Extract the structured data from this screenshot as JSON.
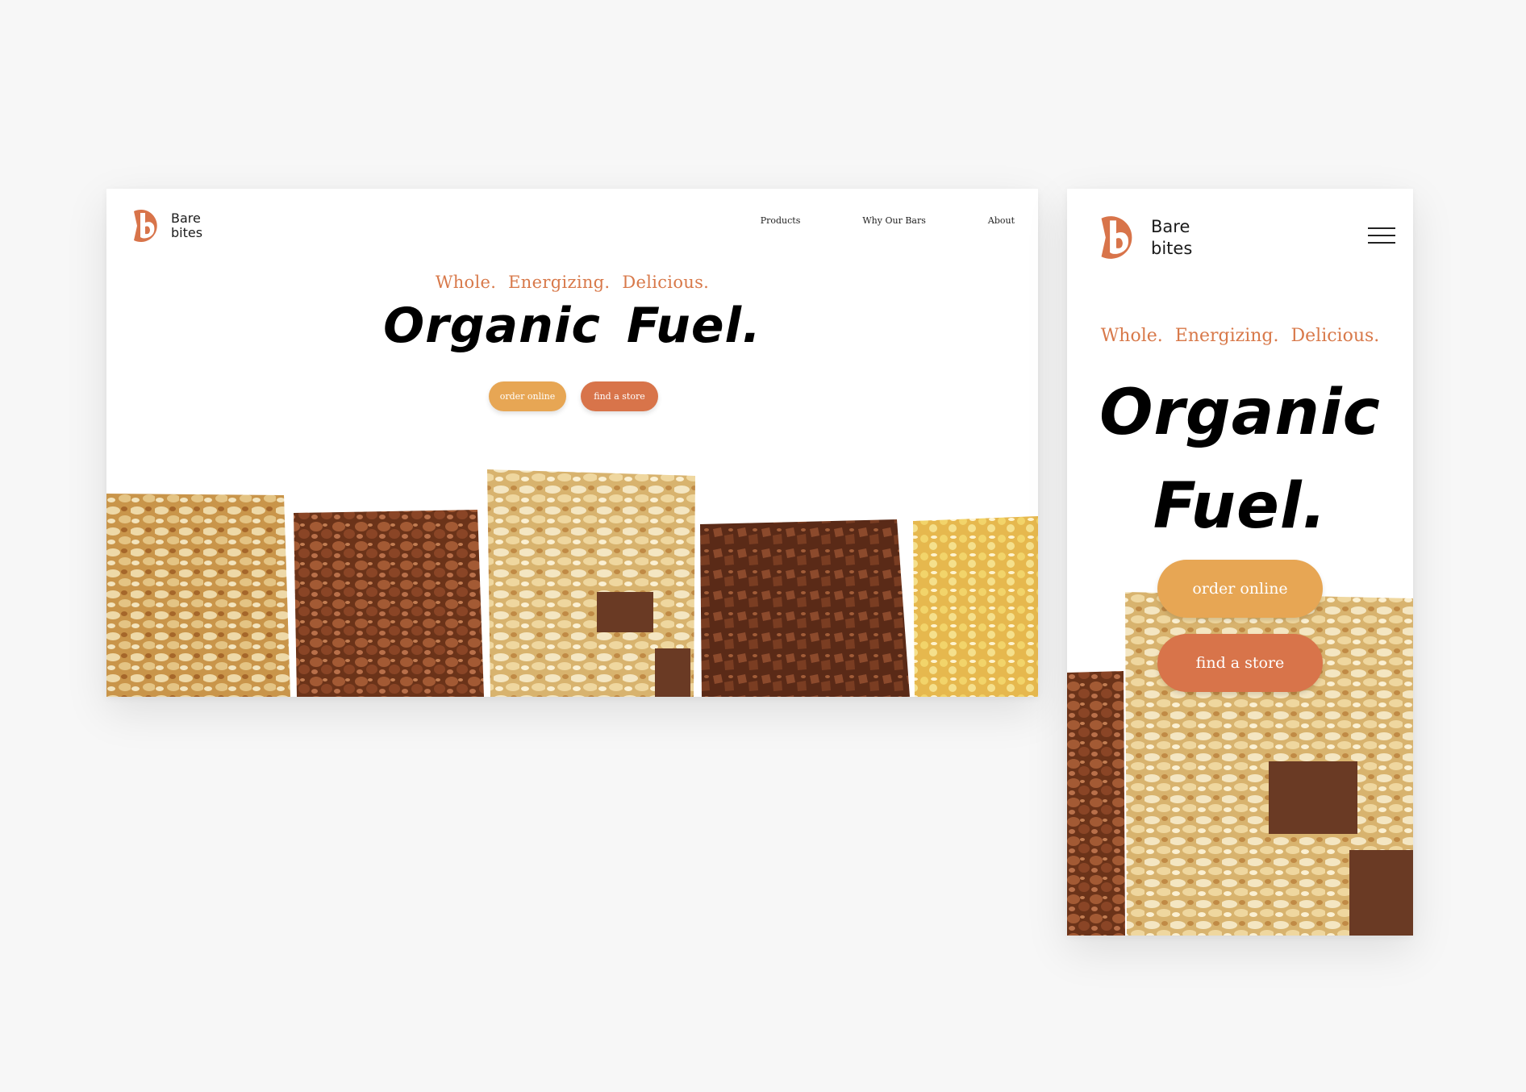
{
  "brand": {
    "line1": "Bare",
    "line2": "bites",
    "color": "#d8744a"
  },
  "nav": {
    "items": [
      "Products",
      "Why Our Bars",
      "About"
    ]
  },
  "hero": {
    "tagline": "Whole.  Energizing.  Delicious.",
    "headline": "Organic  Fuel.",
    "order_label": "order online",
    "store_label": "find a store",
    "order_color": "#e7a654",
    "store_color": "#d8744a"
  },
  "icons": {
    "logo": "b-logo-icon",
    "menu": "hamburger-menu-icon",
    "hero_image": "granola-bars-image"
  }
}
